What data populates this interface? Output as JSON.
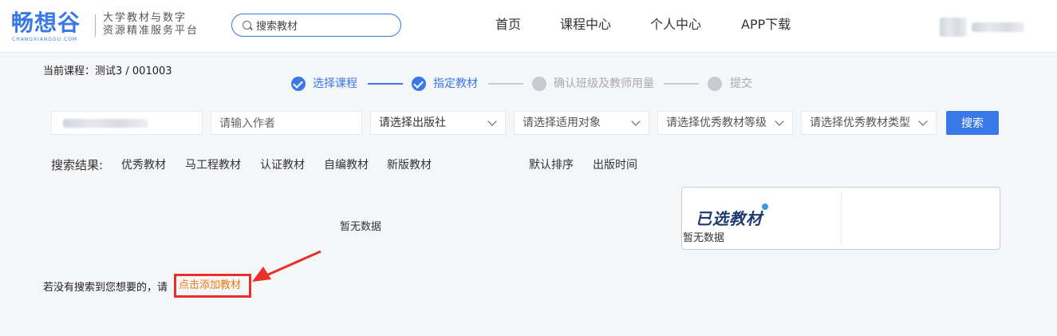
{
  "header": {
    "logo_text": "畅想谷",
    "logo_sub": "CHANGXIANGGU.COM",
    "slogan_line1": "大学教材与数字",
    "slogan_line2": "资源精准服务平台",
    "search_placeholder": "搜索教材",
    "nav": [
      "首页",
      "课程中心",
      "个人中心",
      "APP下载"
    ]
  },
  "course": {
    "label": "当前课程：测试3 / 001003"
  },
  "steps": [
    {
      "label": "选择课程",
      "state": "done"
    },
    {
      "label": "指定教材",
      "state": "done"
    },
    {
      "label": "确认班级及教师用量",
      "state": "todo"
    },
    {
      "label": "提交",
      "state": "todo"
    }
  ],
  "filters": {
    "author_placeholder": "请输入作者",
    "publisher": "请选择出版社",
    "audience": "请选择适用对象",
    "level": "请选择优秀教材等级",
    "type": "请选择优秀教材类型",
    "search_button": "搜索"
  },
  "results": {
    "label": "搜索结果:",
    "tabs": [
      "优秀教材",
      "马工程教材",
      "认证教材",
      "自编教材",
      "新版教材"
    ],
    "sort": [
      "默认排序",
      "出版时间"
    ],
    "empty": "暂无数据"
  },
  "selected": {
    "title": "已选教材",
    "empty": "暂无数据"
  },
  "footer": {
    "hint": "若没有搜索到您想要的，请",
    "add_link": "点击添加教材"
  },
  "colors": {
    "accent": "#3a78e8",
    "highlight_border": "#e8302a",
    "link": "#f07a10"
  }
}
